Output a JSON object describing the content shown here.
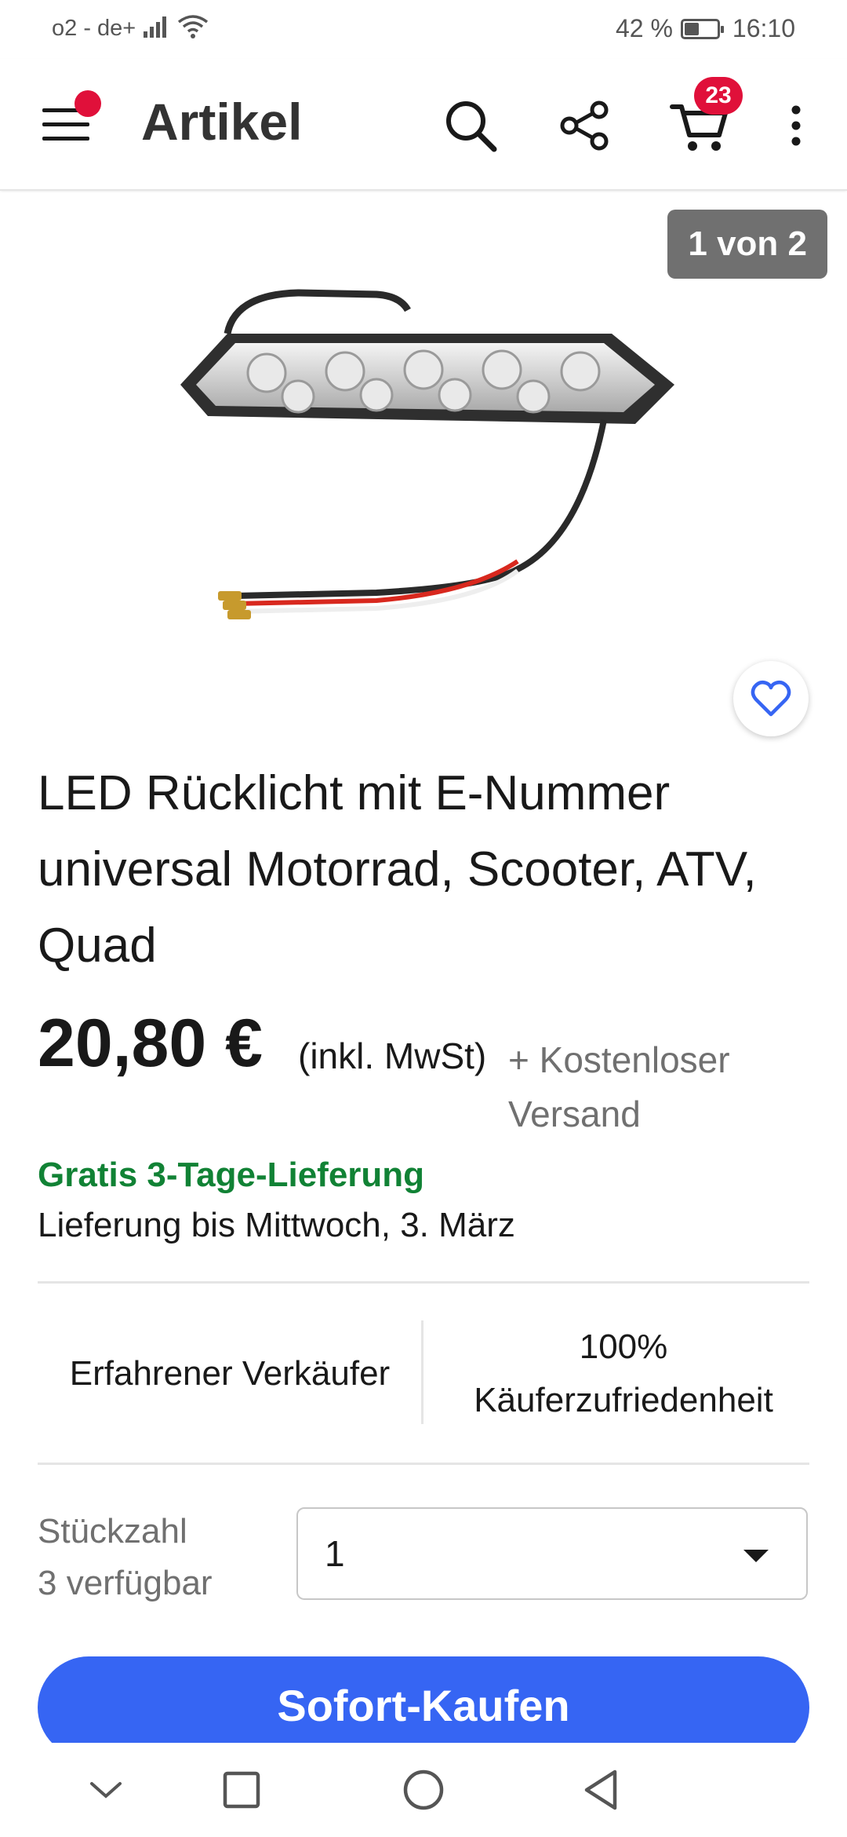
{
  "status_bar": {
    "carrier": "o2 - de+",
    "battery_percent": "42 %",
    "battery_level": 0.42,
    "time": "16:10"
  },
  "header": {
    "title": "Artikel",
    "cart_count": "23",
    "icons": [
      "menu-icon",
      "search-icon",
      "share-icon",
      "cart-icon",
      "more-vertical-icon"
    ]
  },
  "gallery": {
    "counter": "1 von 2"
  },
  "product": {
    "title": "LED Rücklicht mit E-Nummer universal Motorrad, Scooter, ATV, Quad",
    "price": "20,80 €",
    "vat_note": "(inkl. MwSt)",
    "shipping": "+ Kostenloser Versand",
    "delivery_title": "Gratis 3-Tage-Lieferung",
    "delivery_date": "Lieferung bis Mittwoch, 3. März"
  },
  "seller": {
    "experience": "Erfahrener Verkäufer",
    "satisfaction_value": "100%",
    "satisfaction_label": "Käuferzufriedenheit"
  },
  "quantity": {
    "label": "Stückzahl",
    "available": "3 verfügbar",
    "selected": "1"
  },
  "actions": {
    "buy_now": "Sofort-Kaufen"
  },
  "colors": {
    "primary_button": "#3665f3",
    "delivery_green": "#118235",
    "badge_red": "#e0103a"
  }
}
